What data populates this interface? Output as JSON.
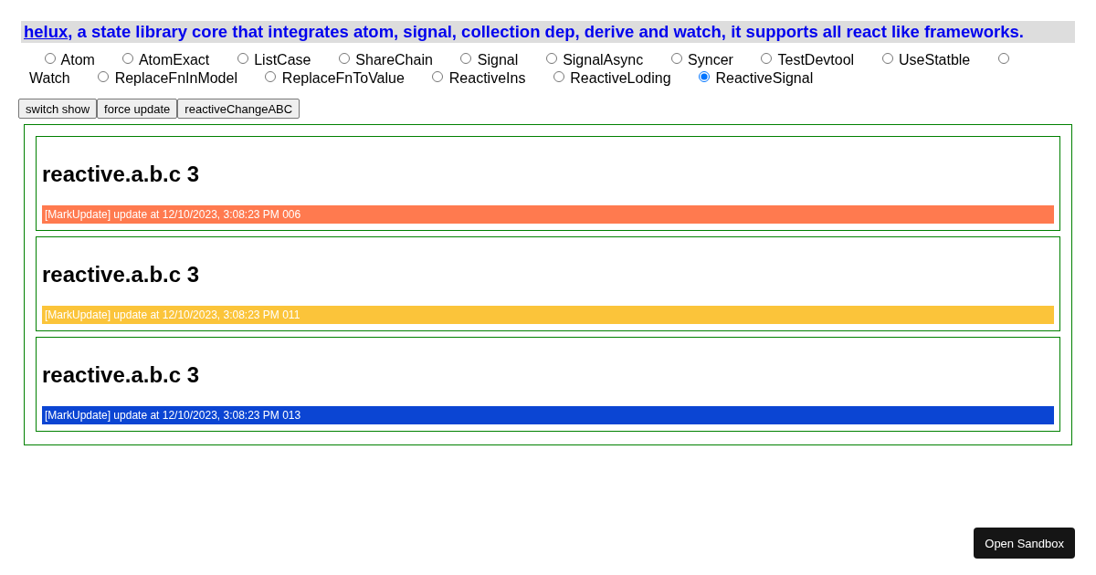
{
  "header": {
    "link": "helux",
    "text": ", a state library core that integrates atom, signal, collection dep, derive and watch, it supports all react like frameworks."
  },
  "options": [
    {
      "label": "Atom",
      "selected": false
    },
    {
      "label": "AtomExact",
      "selected": false
    },
    {
      "label": "ListCase",
      "selected": false
    },
    {
      "label": "ShareChain",
      "selected": false
    },
    {
      "label": "Signal",
      "selected": false
    },
    {
      "label": "SignalAsync",
      "selected": false
    },
    {
      "label": "Syncer",
      "selected": false
    },
    {
      "label": "TestDevtool",
      "selected": false
    },
    {
      "label": "UseStatble",
      "selected": false
    },
    {
      "label": "Watch",
      "selected": false
    },
    {
      "label": "ReplaceFnInModel",
      "selected": false
    },
    {
      "label": "ReplaceFnToValue",
      "selected": false
    },
    {
      "label": "ReactiveIns",
      "selected": false
    },
    {
      "label": "ReactiveLoding",
      "selected": false
    },
    {
      "label": "ReactiveSignal",
      "selected": true
    }
  ],
  "buttons": [
    "switch show",
    "force update",
    "reactiveChangeABC"
  ],
  "cards": [
    {
      "heading": "reactive.a.b.c 3",
      "update": "[MarkUpdate] update at 12/10/2023, 3:08:23 PM 006",
      "color": "#ff7a4f"
    },
    {
      "heading": "reactive.a.b.c 3",
      "update": "[MarkUpdate] update at 12/10/2023, 3:08:23 PM 011",
      "color": "#fbc43a"
    },
    {
      "heading": "reactive.a.b.c 3",
      "update": "[MarkUpdate] update at 12/10/2023, 3:08:23 PM 013",
      "color": "#0b45d3"
    }
  ],
  "sandbox_button": "Open Sandbox"
}
